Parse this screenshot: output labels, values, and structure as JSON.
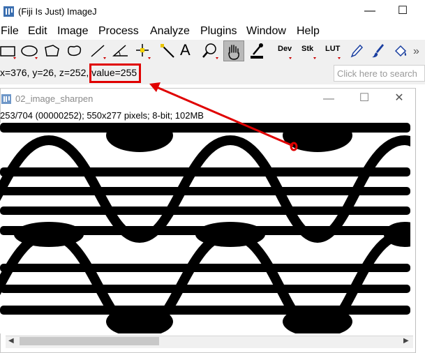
{
  "main_window": {
    "title": "(Fiji Is Just) ImageJ",
    "minimize": "—",
    "maximize": "☐"
  },
  "menu": [
    "File",
    "Edit",
    "Image",
    "Process",
    "Analyze",
    "Plugins",
    "Window",
    "Help"
  ],
  "toolbar": {
    "text_tool": "A",
    "dev": "Dev",
    "stk": "Stk",
    "lut": "LUT",
    "selected_tool": "hand"
  },
  "status": {
    "coords": "x=376, y=26, z=252, ",
    "value": "value=255"
  },
  "search": {
    "placeholder": "Click here to search"
  },
  "image_window": {
    "title": "02_image_sharpen",
    "info": "253/704 (00000252); 550x277 pixels; 8-bit; 102MB",
    "minimize": "—",
    "maximize": "☐",
    "close": "✕"
  },
  "colors": {
    "highlight_box": "#e00000",
    "arrow": "#e00000",
    "selected_tool_bg": "#b9b9b9"
  }
}
